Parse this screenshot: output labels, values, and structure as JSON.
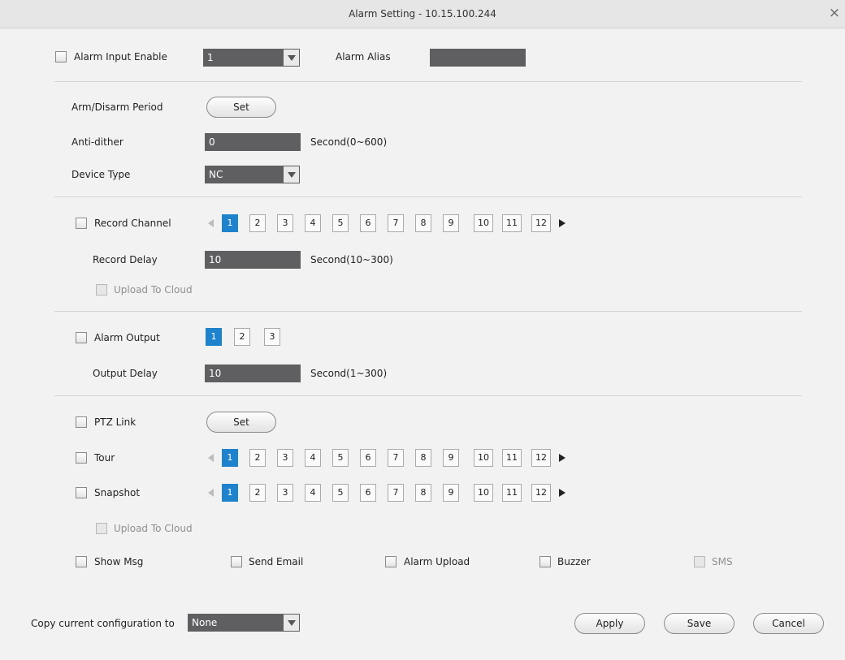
{
  "window": {
    "title": "Alarm Setting - 10.15.100.244",
    "close_glyph": "×"
  },
  "alarm_input": {
    "label": "Alarm Input Enable",
    "channel": "1",
    "alias_label": "Alarm Alias",
    "alias_value": ""
  },
  "arm_disarm": {
    "label": "Arm/Disarm Period",
    "button": "Set"
  },
  "anti_dither": {
    "label": "Anti-dither",
    "value": "0",
    "unit": "Second(0~600)"
  },
  "device_type": {
    "label": "Device Type",
    "value": "NC"
  },
  "record_channel": {
    "label": "Record Channel",
    "channels": [
      "1",
      "2",
      "3",
      "4",
      "5",
      "6",
      "7",
      "8",
      "9",
      "10",
      "11",
      "12"
    ],
    "selected": "1"
  },
  "record_delay": {
    "label": "Record Delay",
    "value": "10",
    "unit": "Second(10~300)"
  },
  "record_upload": {
    "label": "Upload To Cloud"
  },
  "alarm_output": {
    "label": "Alarm Output",
    "outputs": [
      "1",
      "2",
      "3"
    ],
    "selected": "1"
  },
  "output_delay": {
    "label": "Output Delay",
    "value": "10",
    "unit": "Second(1~300)"
  },
  "ptz_link": {
    "label": "PTZ Link",
    "button": "Set"
  },
  "tour": {
    "label": "Tour",
    "channels": [
      "1",
      "2",
      "3",
      "4",
      "5",
      "6",
      "7",
      "8",
      "9",
      "10",
      "11",
      "12"
    ],
    "selected": "1"
  },
  "snapshot": {
    "label": "Snapshot",
    "channels": [
      "1",
      "2",
      "3",
      "4",
      "5",
      "6",
      "7",
      "8",
      "9",
      "10",
      "11",
      "12"
    ],
    "selected": "1"
  },
  "snapshot_upload": {
    "label": "Upload To Cloud"
  },
  "options": {
    "show_msg": "Show Msg",
    "send_email": "Send Email",
    "alarm_upload": "Alarm Upload",
    "buzzer": "Buzzer",
    "sms": "SMS"
  },
  "footer": {
    "copy_label": "Copy current configuration to",
    "copy_value": "None",
    "apply": "Apply",
    "save": "Save",
    "cancel": "Cancel"
  },
  "colors": {
    "selected_blue": "#1e83cc",
    "field_bg": "#5f5f62"
  }
}
